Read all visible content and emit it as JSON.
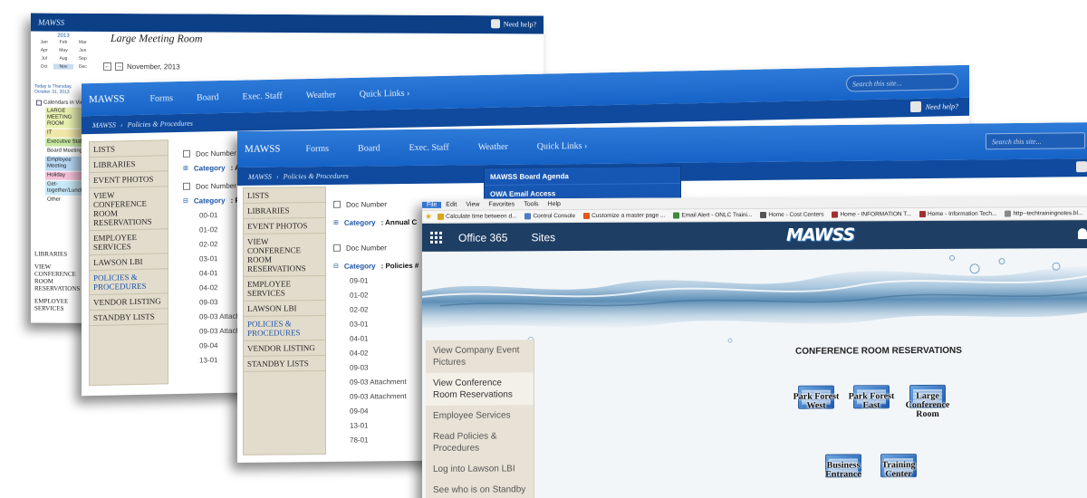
{
  "calendar_screen": {
    "site": "MAWSS",
    "need_help": "Need help?",
    "title": "Large Meeting Room",
    "current_month": "November, 2013",
    "prev_label": "←",
    "next_label": "→",
    "mini_year": "2013",
    "mini_months": [
      "Jan",
      "Feb",
      "Mar",
      "Apr",
      "May",
      "Jun",
      "Jul",
      "Aug",
      "Sep",
      "Oct",
      "Nov",
      "Dec"
    ],
    "today": "Today is Thursday, October 31, 2013",
    "calendars_label": "Calendars in View",
    "calendars": [
      {
        "name": "LARGE MEETING ROOM",
        "color": "#e8f0b0"
      },
      {
        "name": "IT",
        "color": "#f0e6a8"
      },
      {
        "name": "Executive Staff",
        "color": "#c8e8a0"
      },
      {
        "name": "Board Meeting",
        "color": "#ffffff"
      },
      {
        "name": "Employee Meeting",
        "color": "#b8d8f4"
      },
      {
        "name": "Holiday",
        "color": "#f4c0d8"
      },
      {
        "name": "Get-together/Lunch",
        "color": "#c8e8f8"
      },
      {
        "name": "Other",
        "color": "#ffffff"
      }
    ],
    "left_links": [
      "LIBRARIES",
      "VIEW CONFERENCE ROOM RESERVATIONS",
      "EMPLOYEE SERVICES"
    ]
  },
  "policies_screen": {
    "site": "MAWSS",
    "nav": [
      "Forms",
      "Board",
      "Exec. Staff",
      "Weather",
      "Quick Links ›"
    ],
    "search_placeholder": "Search this site...",
    "breadcrumb": [
      "MAWSS",
      "Policies & Procedures"
    ],
    "breadcrumb_sep": "›",
    "need_help": "Need help?",
    "side": [
      "LISTS",
      "LIBRARIES",
      "EVENT PHOTOS",
      "VIEW CONFERENCE ROOM RESERVATIONS",
      "EMPLOYEE SERVICES",
      "LAWSON LBI",
      "POLICIES & PROCEDURES",
      "VENDOR LISTING",
      "STANDBY LISTS"
    ],
    "doc_number_label": "Doc Number",
    "category_label": "Category",
    "category_1": ": A",
    "category_2": ": P",
    "codes": [
      "00-01",
      "01-02",
      "02-02",
      "03-01",
      "04-01",
      "04-02",
      "09-03",
      "09-03 Attachment",
      "09-03 Attachment",
      "09-04",
      "13-01"
    ]
  },
  "policies_screen_2": {
    "site": "MAWSS",
    "nav": [
      "Forms",
      "Board",
      "Exec. Staff",
      "Weather",
      "Quick Links ›"
    ],
    "search_placeholder": "Search this site...",
    "breadcrumb": [
      "MAWSS",
      "Policies & Procedures"
    ],
    "breadcrumb_sep": "›",
    "side": [
      "LISTS",
      "LIBRARIES",
      "EVENT PHOTOS",
      "VIEW CONFERENCE ROOM RESERVATIONS",
      "EMPLOYEE SERVICES",
      "LAWSON LBI",
      "POLICIES & PROCEDURES",
      "VENDOR LISTING",
      "STANDBY LISTS"
    ],
    "quick_links": [
      "MAWSS Board Agenda",
      "OWA Email Access"
    ],
    "doc_number_label": "Doc Number",
    "category_label": "Category",
    "category_1": ": Annual C",
    "category_2": ": Policies #",
    "codes": [
      "09-01",
      "01-02",
      "02-02",
      "03-01",
      "04-01",
      "04-02",
      "09-03",
      "09-03 Attachment",
      "09-03 Attachment",
      "09-04",
      "13-01",
      "78-01"
    ]
  },
  "office_screen": {
    "menu": [
      "File",
      "Edit",
      "View",
      "Favorites",
      "Tools",
      "Help"
    ],
    "favorites": [
      {
        "label": "Calculate time between d...",
        "color": "#d9a419"
      },
      {
        "label": "Control Console",
        "color": "#4c7bc2"
      },
      {
        "label": "Customize a master page ...",
        "color": "#e2561f"
      },
      {
        "label": "Email Alert - ONLC Traini...",
        "color": "#3a8a3a"
      },
      {
        "label": "Home - Cost Centers",
        "color": "#555555"
      },
      {
        "label": "Home - INFORMATION T...",
        "color": "#a03030"
      },
      {
        "label": "Home - Information Tech...",
        "color": "#a03030"
      },
      {
        "label": "http--techtrainingnotes.bl...",
        "color": "#888888"
      }
    ],
    "app_title": "Office 365",
    "sites_label": "Sites",
    "logo_text": "MAWSS",
    "left_nav": [
      "View Company Event Pictures",
      "View Conference Room Reservations",
      "Employee Services",
      "Read Policies & Procedures",
      "Log into Lawson LBI",
      "See who is on Standby"
    ],
    "heading": "CONFERENCE ROOM RESERVATIONS",
    "rooms": [
      "Park Forest West",
      "Park Forest East",
      "Large Conference Room",
      "Business Entrance",
      "Training Center"
    ],
    "accent": "#1e3e64"
  }
}
